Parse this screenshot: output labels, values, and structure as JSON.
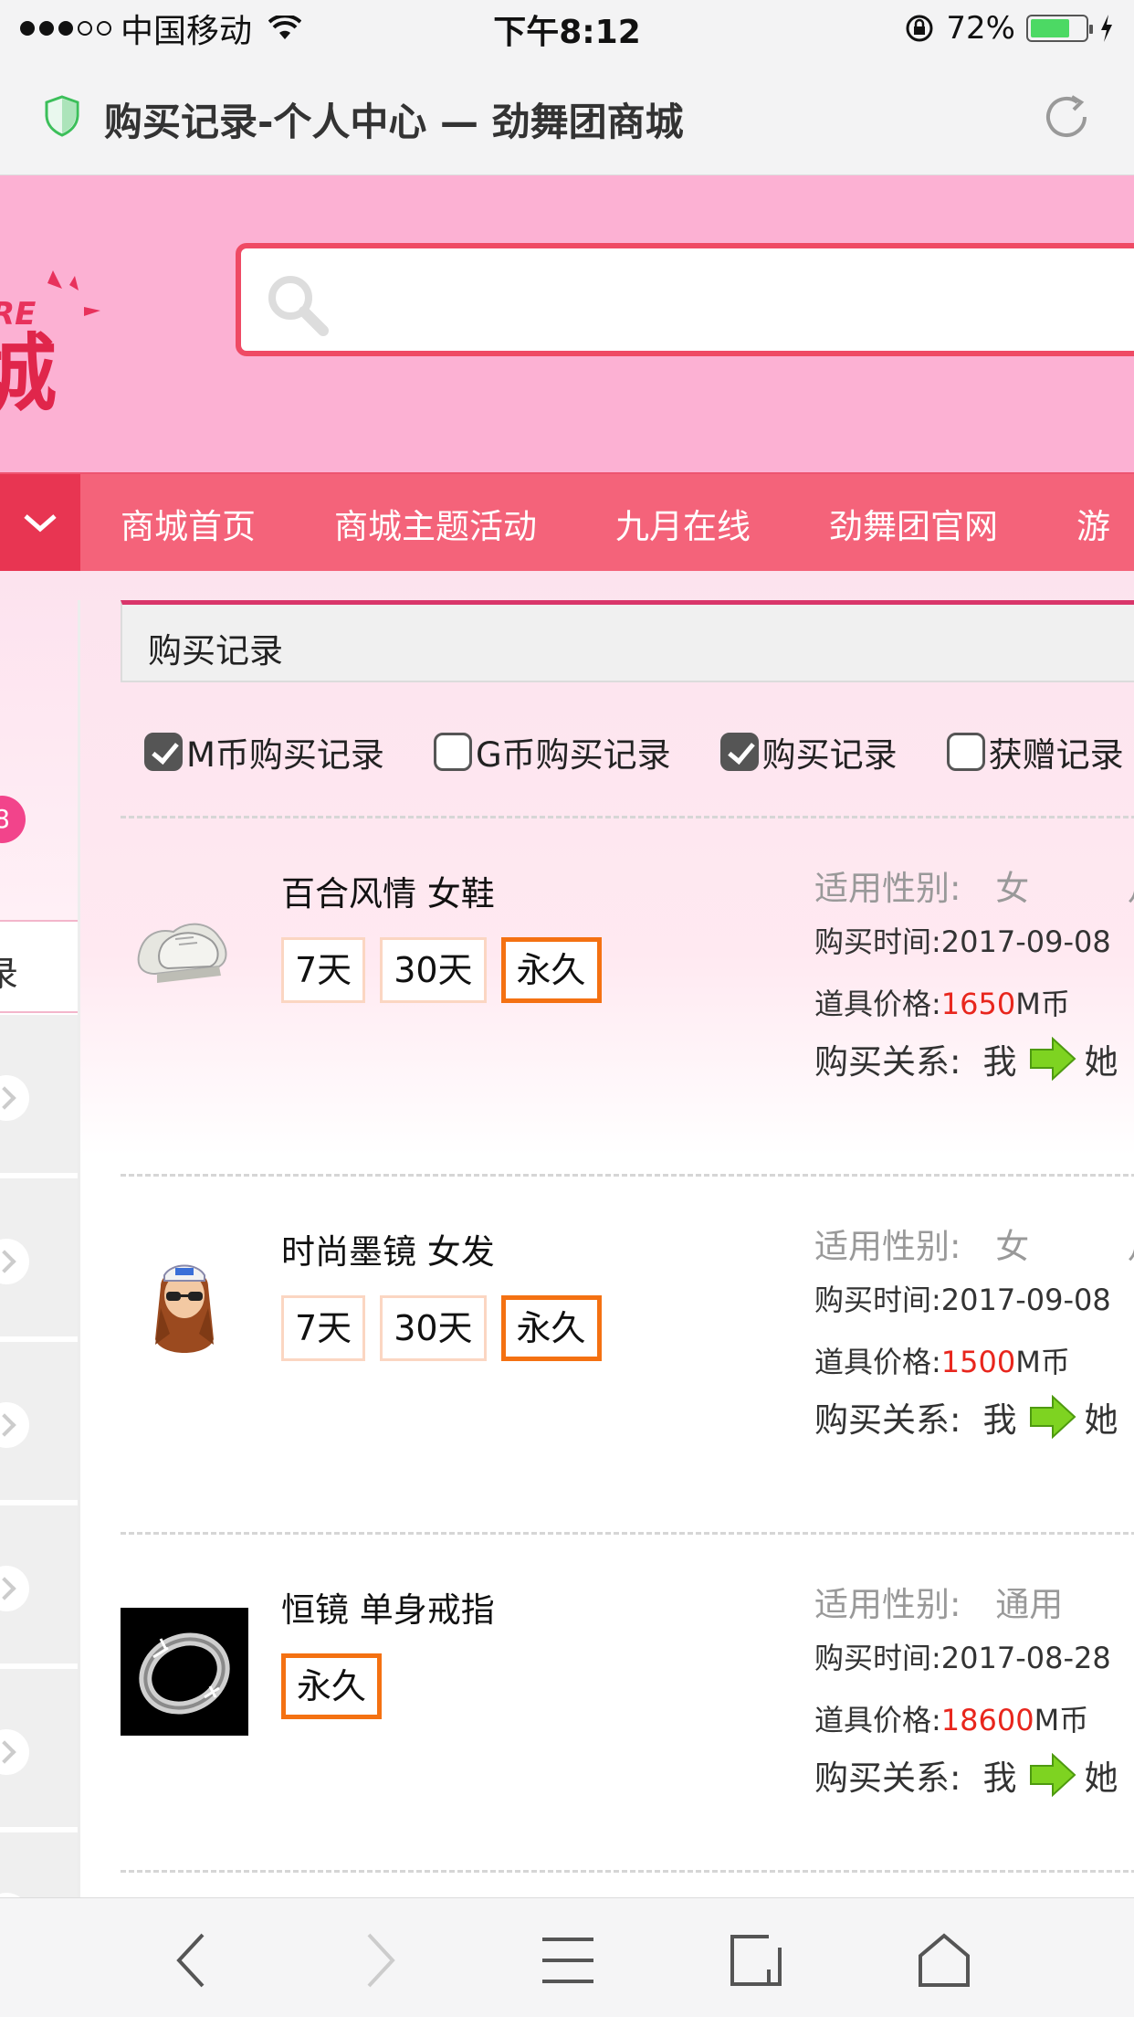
{
  "status_bar": {
    "carrier": "中国移动",
    "time": "下午8:12",
    "battery_percent": "72%",
    "battery_level": 0.72
  },
  "url_bar": {
    "title": "购买记录-个人中心 — 劲舞团商城"
  },
  "site": {
    "logo_text_partial": "RE",
    "logo_char_partial": "城"
  },
  "nav": {
    "items": [
      "商城首页",
      "商城主题活动",
      "九月在线",
      "劲舞团官网",
      "游"
    ]
  },
  "sidebar": {
    "badge": "8",
    "selected_partial": "录"
  },
  "section": {
    "title": "购买记录"
  },
  "filters": [
    {
      "label": "M币购买记录",
      "checked": true
    },
    {
      "label": "G币购买记录",
      "checked": false
    },
    {
      "label": "购买记录",
      "checked": true
    },
    {
      "label": "获赠记录",
      "checked": false
    }
  ],
  "labels": {
    "gender": "适用性别:",
    "time": "购买时间:",
    "price": "道具价格:",
    "relation": "购买关系:",
    "me": "我",
    "her": "她",
    "currency": "M币",
    "gender_extra": "月"
  },
  "records": [
    {
      "name": "百合风情 女鞋",
      "durations": [
        "7天",
        "30天",
        "永久"
      ],
      "active_duration": "永久",
      "gender": "女",
      "time": "2017-09-08",
      "price": "1650",
      "icon": "white-shoes"
    },
    {
      "name": "时尚墨镜 女发",
      "durations": [
        "7天",
        "30天",
        "永久"
      ],
      "active_duration": "永久",
      "gender": "女",
      "time": "2017-09-08",
      "price": "1500",
      "icon": "girl-hair-sunglasses"
    },
    {
      "name": "恒镜 单身戒指",
      "durations": [
        "永久"
      ],
      "active_duration": "永久",
      "gender": "通用",
      "time": "2017-08-28",
      "price": "18600",
      "icon": "silver-ring"
    }
  ],
  "colors": {
    "header_pink": "#fcb1d3",
    "nav_red": "#f4637a",
    "search_border": "#ef4a64",
    "price_red": "#e8261d",
    "active_orange": "#f47112"
  }
}
